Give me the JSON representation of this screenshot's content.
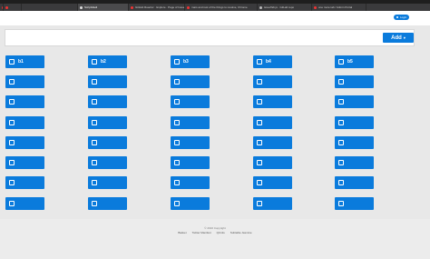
{
  "browser": {
    "tabs": [
      {
        "title": ""
      },
      {
        "title": ""
      },
      {
        "title": "ScriptVault"
      },
      {
        "title": "GitHub Reactor · Explore · Page of Issue Manifest"
      },
      {
        "title": "mars and rest of the things to resolve, Chrome"
      },
      {
        "title": "issueTab.js · GitLab repo"
      },
      {
        "title": "one more tab / Admin Portal"
      }
    ]
  },
  "header": {
    "login_label": "Login"
  },
  "toolbar": {
    "add_label": "Add",
    "add_caret": "▾"
  },
  "buckets": [
    [
      "b1",
      "b2",
      "b3",
      "b4",
      "b5"
    ],
    [
      "",
      "",
      "",
      "",
      ""
    ],
    [
      "",
      "",
      "",
      "",
      ""
    ],
    [
      "",
      "",
      "",
      "",
      ""
    ],
    [
      "",
      "",
      "",
      "",
      ""
    ],
    [
      "",
      "",
      "",
      "",
      ""
    ],
    [
      "",
      "",
      "",
      "",
      ""
    ],
    [
      "",
      "",
      "",
      "",
      ""
    ]
  ],
  "footer": {
    "copyright": "© 2016 Copyright",
    "links": [
      "Basket",
      "Twitter Manifest",
      "QUnits",
      "Subtable Jasmine"
    ]
  },
  "colors": {
    "accent": "#0a7bdc",
    "content_bg": "#e8e8e8"
  }
}
